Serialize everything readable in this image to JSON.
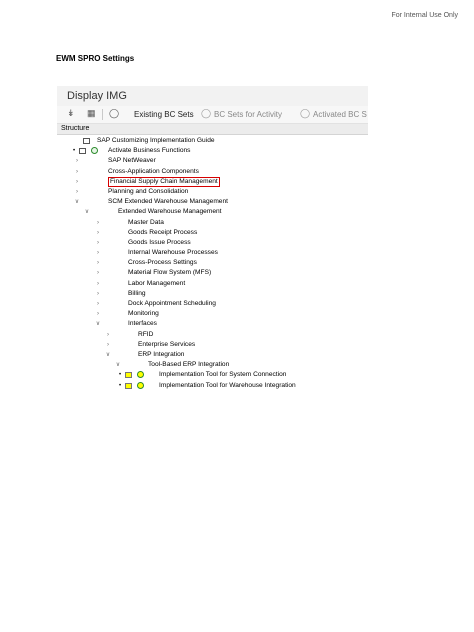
{
  "header_note": "For Internal Use Only",
  "doc_heading": "EWM SPRO Settings",
  "screenshot": {
    "window_title": "Display IMG",
    "toolbar": {
      "icons": [
        "double-chevron-down-icon",
        "table-icon"
      ],
      "buttons": [
        {
          "label": "Existing BC Sets",
          "icon": "bc-set-icon"
        },
        {
          "label": "BC Sets for Activity",
          "icon": "bc-set-icon"
        },
        {
          "label": "Activated BC S",
          "icon": "bc-set-icon"
        }
      ]
    },
    "structure_label": "Structure",
    "tree": [
      {
        "label": "SAP Customizing Implementation Guide",
        "level": 0,
        "arrow": "",
        "icons": [
          "doc-icon"
        ]
      },
      {
        "label": "Activate Business Functions",
        "level": 1,
        "arrow": "",
        "icons": [
          "doc-icon",
          "clock-icon"
        ],
        "bullet": true
      },
      {
        "label": "SAP NetWeaver",
        "level": 1,
        "arrow": ">"
      },
      {
        "label": "Cross-Application Components",
        "level": 1,
        "arrow": ">"
      },
      {
        "label": "Financial Supply Chain Management",
        "level": 1,
        "arrow": ">",
        "highlighted_box": true
      },
      {
        "label": "Planning and Consolidation",
        "level": 1,
        "arrow": ">"
      },
      {
        "label": "SCM Extended Warehouse Management",
        "level": 1,
        "arrow": "v"
      },
      {
        "label": "Extended Warehouse Management",
        "level": 2,
        "arrow": "v"
      },
      {
        "label": "Master Data",
        "level": 3,
        "arrow": ">"
      },
      {
        "label": "Goods Receipt Process",
        "level": 3,
        "arrow": ">"
      },
      {
        "label": "Goods Issue Process",
        "level": 3,
        "arrow": ">"
      },
      {
        "label": "Internal Warehouse Processes",
        "level": 3,
        "arrow": ">"
      },
      {
        "label": "Cross-Process Settings",
        "level": 3,
        "arrow": ">"
      },
      {
        "label": "Material Flow System (MFS)",
        "level": 3,
        "arrow": ">"
      },
      {
        "label": "Labor Management",
        "level": 3,
        "arrow": ">"
      },
      {
        "label": "Billing",
        "level": 3,
        "arrow": ">"
      },
      {
        "label": "Dock Appointment Scheduling",
        "level": 3,
        "arrow": ">"
      },
      {
        "label": "Monitoring",
        "level": 3,
        "arrow": ">"
      },
      {
        "label": "Interfaces",
        "level": 3,
        "arrow": "v"
      },
      {
        "label": "RFID",
        "level": 4,
        "arrow": ">"
      },
      {
        "label": "Enterprise Services",
        "level": 4,
        "arrow": ">"
      },
      {
        "label": "ERP Integration",
        "level": 4,
        "arrow": "v"
      },
      {
        "label": "Tool-Based ERP Integration",
        "level": 5,
        "arrow": "v"
      },
      {
        "label": "Implementation Tool for System Connection",
        "level": 6,
        "arrow": "",
        "icons": [
          "doc-icon",
          "clock-icon"
        ],
        "bullet": true,
        "icon_highlight": true
      },
      {
        "label": "Implementation Tool for Warehouse Integration",
        "level": 6,
        "arrow": "",
        "icons": [
          "doc-icon",
          "clock-icon"
        ],
        "bullet": true,
        "icon_highlight": true
      }
    ]
  },
  "colors": {
    "highlight_yellow": "#ffff00",
    "annotation_red": "#d60000",
    "clock_green": "#2b8a2b"
  }
}
